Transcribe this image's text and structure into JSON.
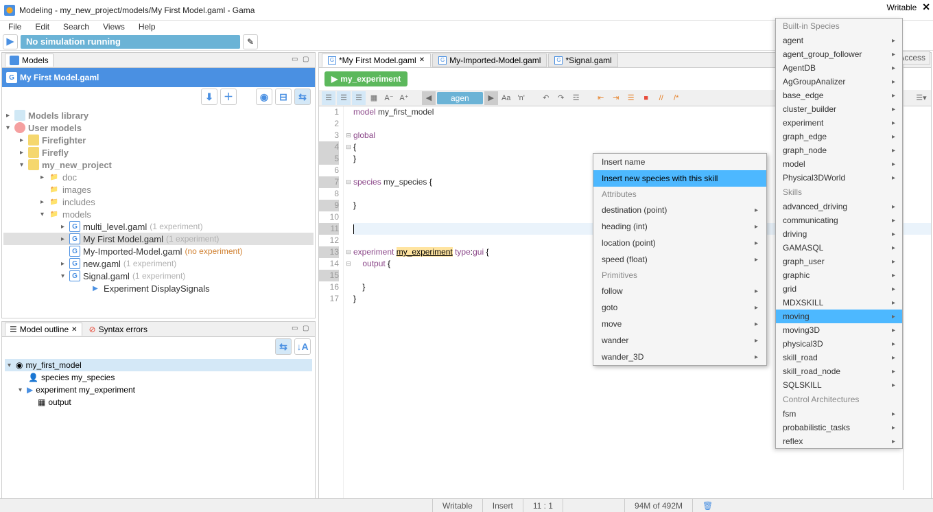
{
  "window_title": "Modeling - my_new_project/models/My First Model.gaml - Gama",
  "menu": [
    "File",
    "Edit",
    "Search",
    "Views",
    "Help"
  ],
  "sim_status": "No simulation running",
  "models_tab": "Models",
  "current_file_header": "My First Model.gaml",
  "tree": {
    "models_library": "Models library",
    "user_models": "User models",
    "firefighter": "Firefighter",
    "firefly": "Firefly",
    "my_project": "my_new_project",
    "doc": "doc",
    "images": "images",
    "includes": "includes",
    "models": "models",
    "files": [
      {
        "name": "multi_level.gaml",
        "badge": "(1 experiment)"
      },
      {
        "name": "My First Model.gaml",
        "badge": "(1 experiment)"
      },
      {
        "name": "My-Imported-Model.gaml",
        "badge": "(no experiment)"
      },
      {
        "name": "new.gaml",
        "badge": "(1 experiment)"
      },
      {
        "name": "Signal.gaml",
        "badge": "(1 experiment)"
      }
    ],
    "experiment_display": "Experiment DisplaySignals"
  },
  "outline_tab": "Model outline",
  "syntax_tab": "Syntax errors",
  "outline": {
    "root": "my_first_model",
    "species": "species my_species",
    "experiment": "experiment my_experiment",
    "output": "output"
  },
  "editor_tabs": [
    {
      "label": "*My First Model.gaml",
      "active": true
    },
    {
      "label": "My-Imported-Model.gaml",
      "active": false
    },
    {
      "label": "*Signal.gaml",
      "active": false
    }
  ],
  "experiment_button": "my_experiment",
  "search_text": "agen",
  "code": {
    "lines": [
      {
        "n": 1,
        "text": "model my_first_model"
      },
      {
        "n": 2,
        "text": ""
      },
      {
        "n": 3,
        "text": "global"
      },
      {
        "n": 4,
        "text": "{"
      },
      {
        "n": 5,
        "text": "}"
      },
      {
        "n": 6,
        "text": ""
      },
      {
        "n": 7,
        "text": "species my_species {"
      },
      {
        "n": 8,
        "text": ""
      },
      {
        "n": 9,
        "text": "}"
      },
      {
        "n": 10,
        "text": ""
      },
      {
        "n": 11,
        "text": ""
      },
      {
        "n": 12,
        "text": ""
      },
      {
        "n": 13,
        "text": "experiment my_experiment type:gui {"
      },
      {
        "n": 14,
        "text": "    output {"
      },
      {
        "n": 15,
        "text": ""
      },
      {
        "n": 16,
        "text": "    }"
      },
      {
        "n": 17,
        "text": "}"
      }
    ]
  },
  "context_menu": {
    "insert_name": "Insert name",
    "insert_species": "Insert new species with this skill",
    "attributes": "Attributes",
    "attr_items": [
      "destination (point)",
      "heading (int)",
      "location (point)",
      "speed (float)"
    ],
    "primitives": "Primitives",
    "prim_items": [
      "follow",
      "goto",
      "move",
      "wander",
      "wander_3D"
    ]
  },
  "side_menu": {
    "built_in": "Built-in Species",
    "species": [
      "agent",
      "agent_group_follower",
      "AgentDB",
      "AgGroupAnalizer",
      "base_edge",
      "cluster_builder",
      "experiment",
      "graph_edge",
      "graph_node",
      "model",
      "Physical3DWorld"
    ],
    "skills_label": "Skills",
    "skills": [
      "advanced_driving",
      "communicating",
      "driving",
      "GAMASQL",
      "graph_user",
      "graphic",
      "grid",
      "MDXSKILL",
      "moving",
      "moving3D",
      "physical3D",
      "skill_road",
      "skill_road_node",
      "SQLSKILL"
    ],
    "control_label": "Control Architectures",
    "controls": [
      "fsm",
      "probabilistic_tasks",
      "reflex"
    ]
  },
  "top_right": {
    "writable": "Writable",
    "access": "Access"
  },
  "status": {
    "writable": "Writable",
    "insert": "Insert",
    "pos": "11 : 1",
    "mem": "94M of 492M"
  }
}
